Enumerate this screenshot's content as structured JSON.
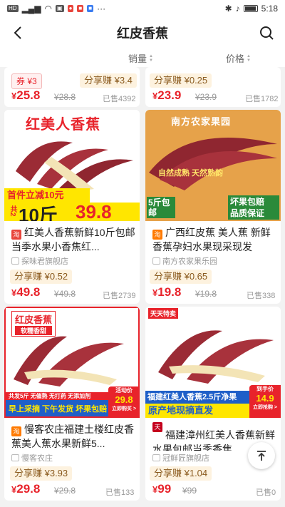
{
  "status": {
    "carrier": "HD",
    "time": "5:18",
    "battery": "93"
  },
  "header": {
    "title": "红皮香蕉"
  },
  "sort": {
    "sales": "销量",
    "price": "价格"
  },
  "top_cards": [
    {
      "coupon": "券 ¥3",
      "share": "分享赚 ¥3.4",
      "price_symbol": "¥",
      "price": "25.8",
      "orig": "¥28.8",
      "sold": "已售4392"
    },
    {
      "share": "分享赚 ¥0.25",
      "price_symbol": "¥",
      "price": "23.9",
      "orig": "¥23.9",
      "sold": "已售1782"
    }
  ],
  "products": [
    {
      "img": {
        "headline": "红美人香蕉",
        "badge1": "首件立减10元",
        "badge2": "共2",
        "big": "10斤",
        "bigprice": "39.8"
      },
      "tag": "淘",
      "title": "红美人香蕉新鲜10斤包邮当季水果小香焦红...",
      "shop": "探味君旗舰店",
      "share": "分享赚 ¥0.52",
      "price_symbol": "¥",
      "price": "49.8",
      "orig": "¥49.8",
      "sold": "已售2739"
    },
    {
      "img": {
        "headline": "南方农家果园",
        "line1": "自然成熟 天然熟韵",
        "left": "5斤包邮",
        "right1": "坏果包赔",
        "right2": "品质保证"
      },
      "tag": "淘",
      "title": "广西红皮蕉 美人蕉 新鲜香蕉孕妇水果现采现发",
      "shop": "南方农家果乐园",
      "share": "分享赚 ¥0.65",
      "price_symbol": "¥",
      "price": "19.8",
      "orig": "¥19.8",
      "sold": "已售338"
    },
    {
      "img": {
        "headline": "红皮香蕉",
        "sub": "软糯香甜",
        "strip": "共发5斤 无催熟 无打药 无添加剂",
        "left": "早上采摘 下午发货 坏果包赔",
        "promo": "活动价",
        "promo_price": "29.8",
        "promo_btn": "立即购买 >"
      },
      "tag": "淘",
      "title": "慢客农庄福建土楼红皮香蕉美人蕉水果新鲜5...",
      "shop": "慢客农庄",
      "share": "分享赚 ¥3.93",
      "price_symbol": "¥",
      "price": "29.8",
      "orig": "¥29.8",
      "sold": "已售133"
    },
    {
      "img": {
        "corner": "天天特卖",
        "band1": "福建红美人香蕉2.5斤净果",
        "band2": "原产地现摘直发",
        "promo": "到手价",
        "promo_price": "14.9",
        "promo_btn": "立即抢购 >"
      },
      "tag": "天猫",
      "title": "福建漳州红美人香蕉新鲜水果包邮当季香焦...",
      "shop": "冠鲜匠旗舰店",
      "share": "分享赚 ¥1.04",
      "price_symbol": "¥",
      "price": "99",
      "orig": "¥99",
      "sold": "已售0"
    }
  ],
  "colors": {
    "price_red": "#e8232b",
    "share_bg": "#fdf2df",
    "banana_red": "#a8323c"
  }
}
